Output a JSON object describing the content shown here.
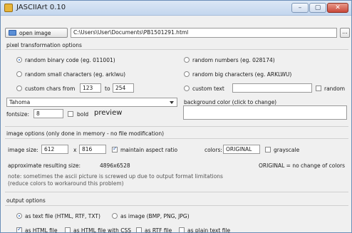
{
  "window": {
    "title": "JASCIIArt 0.10",
    "controls": {
      "minimize": "–",
      "maximize": "▢",
      "close": "✕"
    }
  },
  "file": {
    "open_label": "open image",
    "path": "C:\\Users\\User\\Documents\\PB1501291.html",
    "browse_label": "..."
  },
  "pixel_transformation": {
    "heading": "pixel transformation options",
    "options": {
      "random_binary": "random binary code (eg. 011001)",
      "random_numbers": "random numbers (eg. 028174)",
      "random_small": "random small characters (eg. arklwu)",
      "random_big": "random big characters (eg. ARKLWU)",
      "custom_chars_from": "custom chars from",
      "custom_text": "custom text",
      "random": "random"
    },
    "selected": "random_binary",
    "chars_from": "123",
    "to_label": "to",
    "chars_to": "254",
    "custom_text_value": "",
    "random_checked": false
  },
  "font": {
    "family": "Tahoma",
    "background_color_label": "background color (click to change)",
    "fontsize_label": "fontsize:",
    "fontsize_value": "8",
    "bold_label": "bold",
    "bold_checked": false,
    "preview_label": "preview"
  },
  "image_options": {
    "heading": "image options (only done in memory - no file modification)",
    "size_label": "image size:",
    "width": "612",
    "x_label": "x",
    "height": "816",
    "maintain_label": "maintain aspect ratio",
    "maintain_checked": true,
    "colors_label": "colors:",
    "colors_value": "ORIGINAL",
    "grayscale_label": "grayscale",
    "grayscale_checked": false,
    "approx_label": "approximate resulting size:",
    "approx_value": "4896x6528",
    "original_note": "ORIGINAL = no change of colors",
    "note_line1": "note: sometimes the ascii picture is screwed up due to output format limitations",
    "note_line2": "(reduce colors to workaround this problem)"
  },
  "output_options": {
    "heading": "output options",
    "as_text": "as text file (HTML, RTF, TXT)",
    "as_image": "as image (BMP, PNG, JPG)",
    "selected": "as_text",
    "formats": {
      "html": "as HTML file",
      "html_css": "as HTML file with CSS",
      "rtf": "as RTF file",
      "plain": "as plain text file"
    },
    "format_checked": {
      "html": true,
      "html_css": false,
      "rtf": false,
      "plain": false
    }
  },
  "colors": {
    "accent": "#3a7bd5",
    "titlebar": "#c3d6ee"
  }
}
